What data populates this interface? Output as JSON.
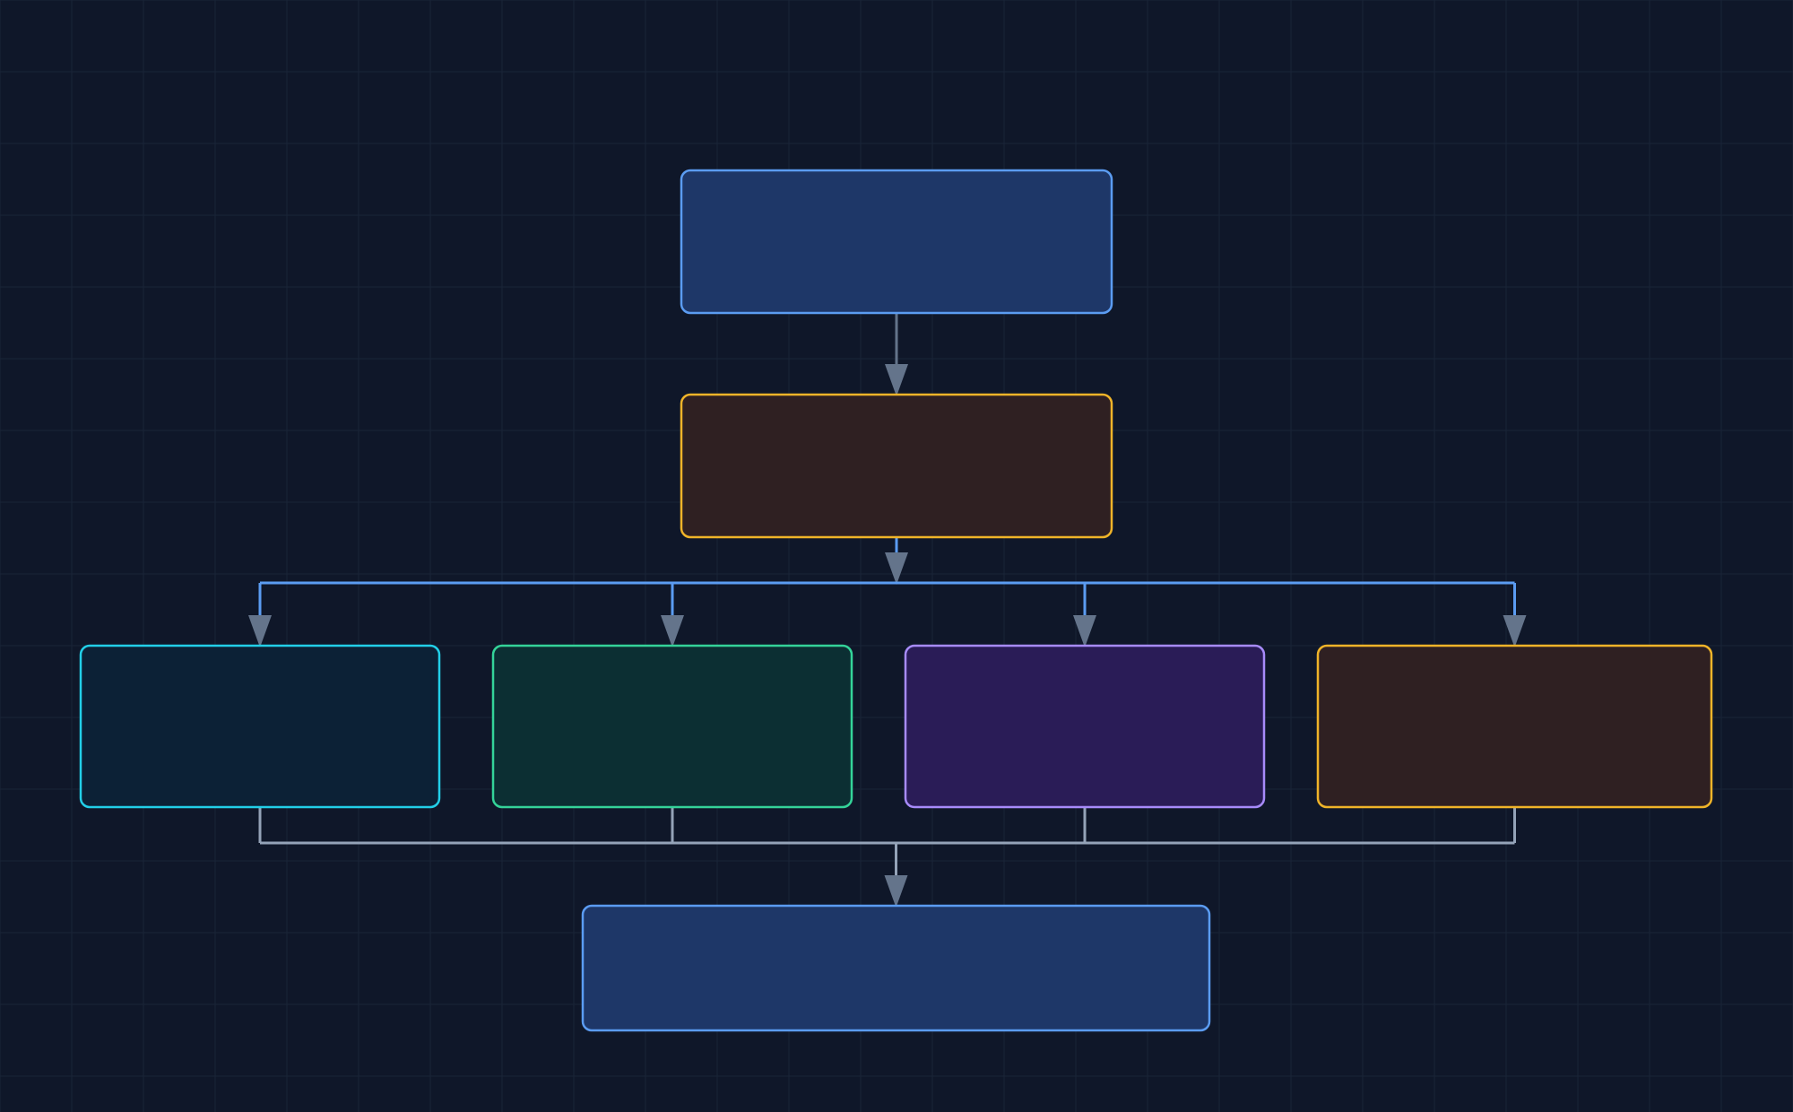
{
  "diagram": {
    "type": "flowchart",
    "nodes": [
      {
        "id": "top",
        "label": "",
        "fill": "#1e3768",
        "stroke": "#5b9cf2"
      },
      {
        "id": "second",
        "label": "",
        "fill": "#2f2022",
        "stroke": "#f0b429"
      },
      {
        "id": "branch-1",
        "label": "",
        "fill": "#0c2136",
        "stroke": "#22cfe8"
      },
      {
        "id": "branch-2",
        "label": "",
        "fill": "#0c2f33",
        "stroke": "#34d399"
      },
      {
        "id": "branch-3",
        "label": "",
        "fill": "#2a1c57",
        "stroke": "#a78bfa"
      },
      {
        "id": "branch-4",
        "label": "",
        "fill": "#2f2022",
        "stroke": "#f0b429"
      },
      {
        "id": "bottom",
        "label": "",
        "fill": "#1e3768",
        "stroke": "#5b9cf2"
      }
    ],
    "edges": [
      {
        "from": "top",
        "to": "second"
      },
      {
        "from": "second",
        "to": "branch-1"
      },
      {
        "from": "second",
        "to": "branch-2"
      },
      {
        "from": "second",
        "to": "branch-3"
      },
      {
        "from": "second",
        "to": "branch-4"
      },
      {
        "from": "branch-1",
        "to": "bottom"
      },
      {
        "from": "branch-2",
        "to": "bottom"
      },
      {
        "from": "branch-3",
        "to": "bottom"
      },
      {
        "from": "branch-4",
        "to": "bottom"
      }
    ]
  },
  "colors": {
    "background": "#0f1729",
    "grid": "#1a2438",
    "fan_out_connector": "#5b9cf2",
    "fan_in_connector": "#94a3b8",
    "arrowhead": "#64748b"
  }
}
